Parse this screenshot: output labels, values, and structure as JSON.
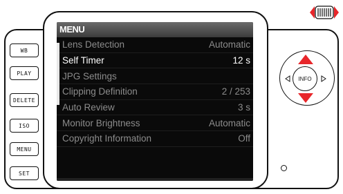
{
  "side_buttons": [
    "WB",
    "PLAY",
    "DELETE",
    "ISO",
    "MENU",
    "SET"
  ],
  "menu": {
    "title": "MENU",
    "items": [
      {
        "label": "Lens Detection",
        "value": "Automatic",
        "selected": false
      },
      {
        "label": "Self Timer",
        "value": "12 s",
        "selected": true
      },
      {
        "label": "JPG Settings",
        "value": "",
        "selected": false
      },
      {
        "label": "Clipping Definition",
        "value": "2 / 253",
        "selected": false
      },
      {
        "label": "Auto Review",
        "value": "3 s",
        "selected": false
      },
      {
        "label": "Monitor Brightness",
        "value": "Automatic",
        "selected": false
      },
      {
        "label": "Copyright Information",
        "value": "Off",
        "selected": false
      }
    ]
  },
  "controls": {
    "info_label": "INFO",
    "arrow_color": "#e8262a"
  },
  "colors": {
    "screen_bg": "#0a0a0a",
    "item_text": "#8c8c8c",
    "selected_text": "#ffffff",
    "accent": "#e8262a"
  }
}
